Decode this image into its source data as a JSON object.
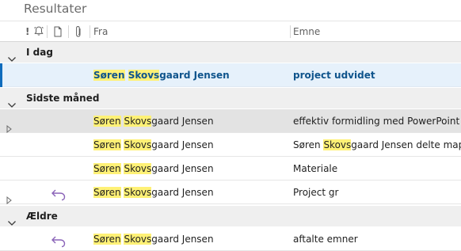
{
  "window": {
    "title": "Resultater"
  },
  "columns": {
    "importance": "!",
    "from": "Fra",
    "subject": "Emne"
  },
  "search": {
    "highlight_term": "Skovs",
    "highlight_color": "#fff176"
  },
  "groups": [
    {
      "label": "I dag",
      "rows": [
        {
          "from_pre": "Søren Skovs",
          "from_hl1": "Søren",
          "from_hl2": "Skovs",
          "from_post": "gaard Jensen",
          "subject_parts": [
            "project udvidet"
          ],
          "selected": true,
          "replied": false,
          "expandable": false
        }
      ]
    },
    {
      "label": "Sidste måned",
      "rows": [
        {
          "from_hl1": "Søren",
          "from_hl2": "Skovs",
          "from_post": "gaard Jensen",
          "subject_parts": [
            "effektiv formidling med PowerPoint"
          ],
          "selected": false,
          "hover": true,
          "replied": false,
          "expandable": true
        },
        {
          "from_hl1": "Søren",
          "from_hl2": "Skovs",
          "from_post": "gaard Jensen",
          "subject_parts": [
            "Søren ",
            "Skovs",
            "gaard Jensen delte map"
          ],
          "selected": false,
          "replied": false,
          "expandable": false
        },
        {
          "from_hl1": "Søren",
          "from_hl2": "Skovs",
          "from_post": "gaard Jensen",
          "subject_parts": [
            "Materiale"
          ],
          "selected": false,
          "replied": false,
          "expandable": false
        },
        {
          "from_hl1": "Søren",
          "from_hl2": "Skovs",
          "from_post": "gaard Jensen",
          "subject_parts": [
            "Project gr"
          ],
          "selected": false,
          "replied": true,
          "expandable": true
        }
      ]
    },
    {
      "label": "Ældre",
      "rows": [
        {
          "from_hl1": "Søren",
          "from_hl2": "Skovs",
          "from_post": "gaard Jensen",
          "subject_parts": [
            "aftalte emner"
          ],
          "selected": false,
          "replied": true,
          "expandable": false
        }
      ]
    }
  ],
  "colors": {
    "accent": "#0f6cbd",
    "selected_row": "#e6f1fb",
    "group_band": "#efefef",
    "reply_icon": "#8a63b8"
  },
  "icons": {
    "importance": "exclamation-icon",
    "reminder": "bell-icon",
    "item_type": "document-icon",
    "attachment": "paperclip-icon",
    "group_toggle": "chevron-down-icon",
    "row_expand": "chevron-right-icon",
    "replied": "reply-arrow-icon"
  }
}
